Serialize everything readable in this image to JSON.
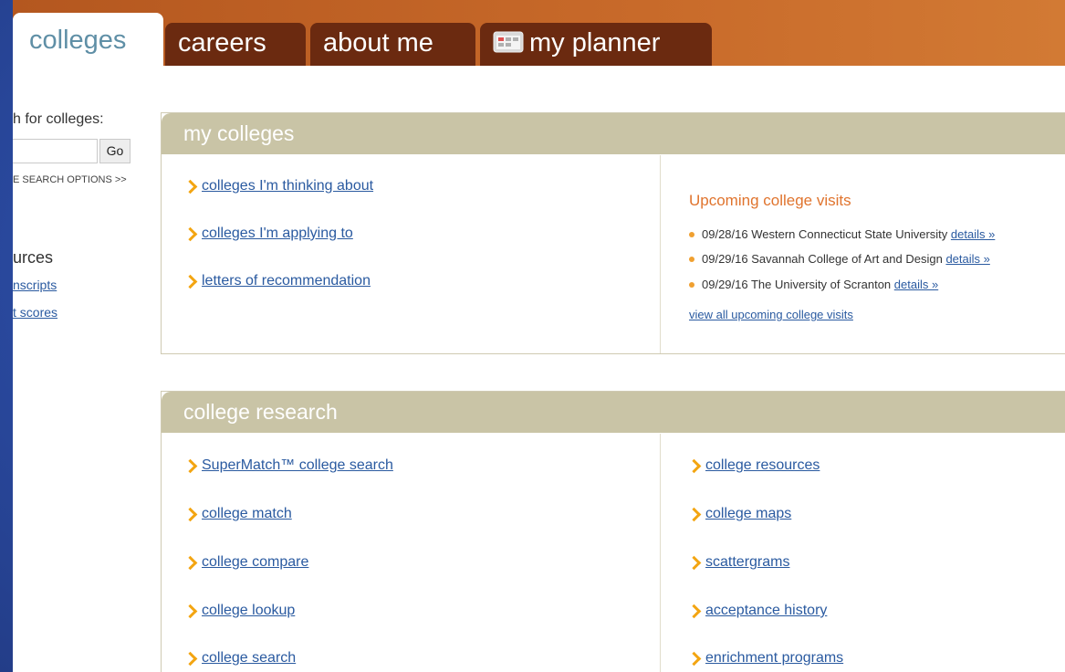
{
  "tabs": {
    "colleges": "colleges",
    "careers": "careers",
    "about_me": "about me",
    "my_planner": "my planner"
  },
  "sidebar": {
    "search_label": "h for colleges:",
    "go_label": "Go",
    "more_options": "E SEARCH OPTIONS >>",
    "resources_heading": "urces",
    "links": [
      "nscripts",
      "t scores"
    ]
  },
  "my_colleges": {
    "title": "my colleges",
    "links": [
      "colleges I'm thinking about",
      "colleges I'm applying to",
      "letters of recommendation"
    ],
    "visits_title": "Upcoming college visits",
    "visits": [
      {
        "text": "09/28/16 Western Connecticut State University",
        "details": "details »"
      },
      {
        "text": "09/29/16 Savannah College of Art and Design",
        "details": "details »"
      },
      {
        "text": "09/29/16 The University of Scranton",
        "details": "details »"
      }
    ],
    "view_all": "view all upcoming college visits"
  },
  "college_research": {
    "title": "college research",
    "left_links": [
      "SuperMatch™ college search",
      "college match",
      "college compare",
      "college lookup",
      "college search"
    ],
    "right_links": [
      "college resources",
      "college maps",
      "scattergrams",
      "acceptance history",
      "enrichment programs"
    ]
  },
  "colors": {
    "accent_orange": "#c86a2a",
    "tab_dark": "#6b2a10",
    "panel_header": "#c9c4a6",
    "link_blue": "#2a5aa0",
    "chevron": "#f3a512"
  }
}
